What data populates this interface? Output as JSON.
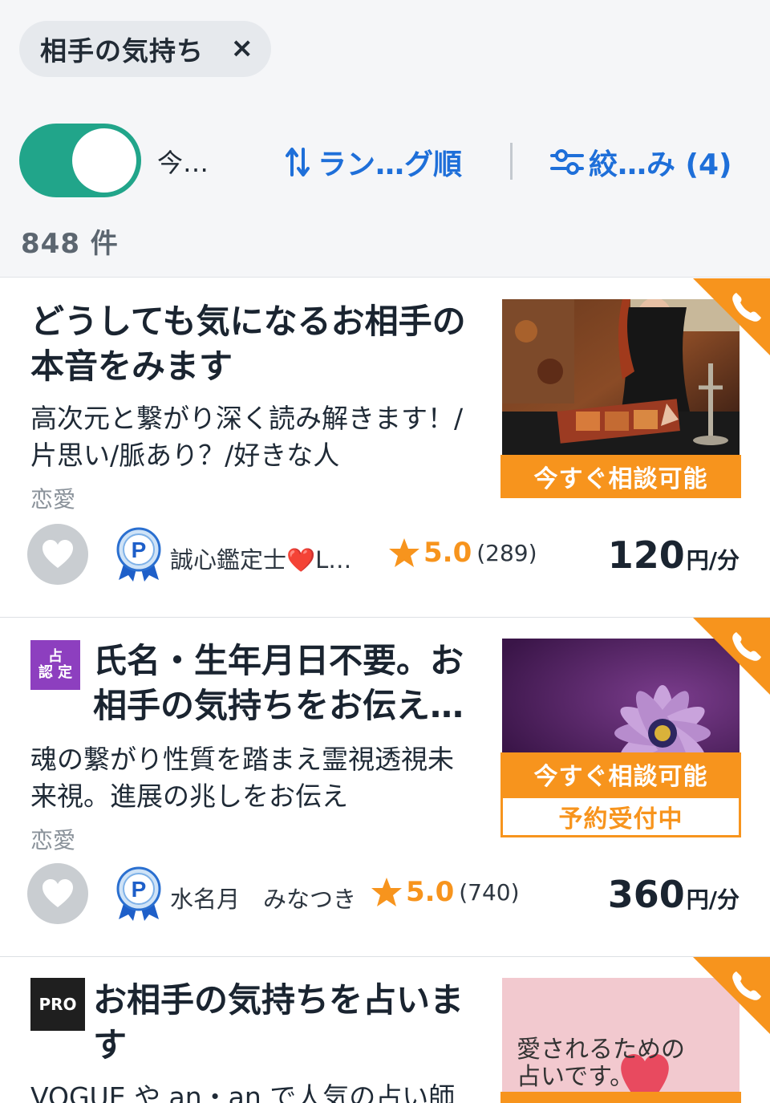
{
  "filter_chip": {
    "label": "相手の気持ち",
    "close": "×"
  },
  "toolbar": {
    "toggle_label": "今…",
    "sort_label": "ラン…グ順",
    "filter_label": "絞…み (4)",
    "count": "848 件"
  },
  "colors": {
    "accent": "#1e6fd9",
    "toggle": "#21a58a",
    "orange": "#f7941d",
    "nintei": "#8d3fbf"
  },
  "listings": [
    {
      "title": "どうしても気になるお相手の本音をみます",
      "description": "高次元と繋がり深く読み解きます！/片思い/脈あり？/好きな人",
      "category": "恋愛",
      "status_now": "今すぐ相談可能",
      "reader": "誠心鑑定士❤️L…",
      "rating": "5.0",
      "reviews": "(289)",
      "price": "120",
      "price_unit": "円/分",
      "icons": [
        "phone-icon",
        "heart-icon",
        "platinum-medal-icon",
        "star-icon"
      ]
    },
    {
      "badge_top": "占",
      "badge_bottom": "認 定",
      "title": "氏名・生年月日不要。お相手の気持ちをお伝え…",
      "description": "魂の繋がり性質を踏まえ霊視透視未来視。進展の兆しをお伝え",
      "category": "恋愛",
      "status_now": "今すぐ相談可能",
      "status_reserve": "予約受付中",
      "reader": "水名月　みなつき",
      "rating": "5.0",
      "reviews": "(740)",
      "price": "360",
      "price_unit": "円/分",
      "icons": [
        "phone-icon",
        "heart-icon",
        "platinum-medal-icon",
        "star-icon"
      ]
    },
    {
      "badge_label": "PRO",
      "title": "お相手の気持ちを占います",
      "description": "VOGUE や an・an で人気の占い師",
      "thumb_caption_line1": "愛されるための",
      "thumb_caption_line2": "占いです。",
      "icons": [
        "phone-icon"
      ]
    }
  ]
}
